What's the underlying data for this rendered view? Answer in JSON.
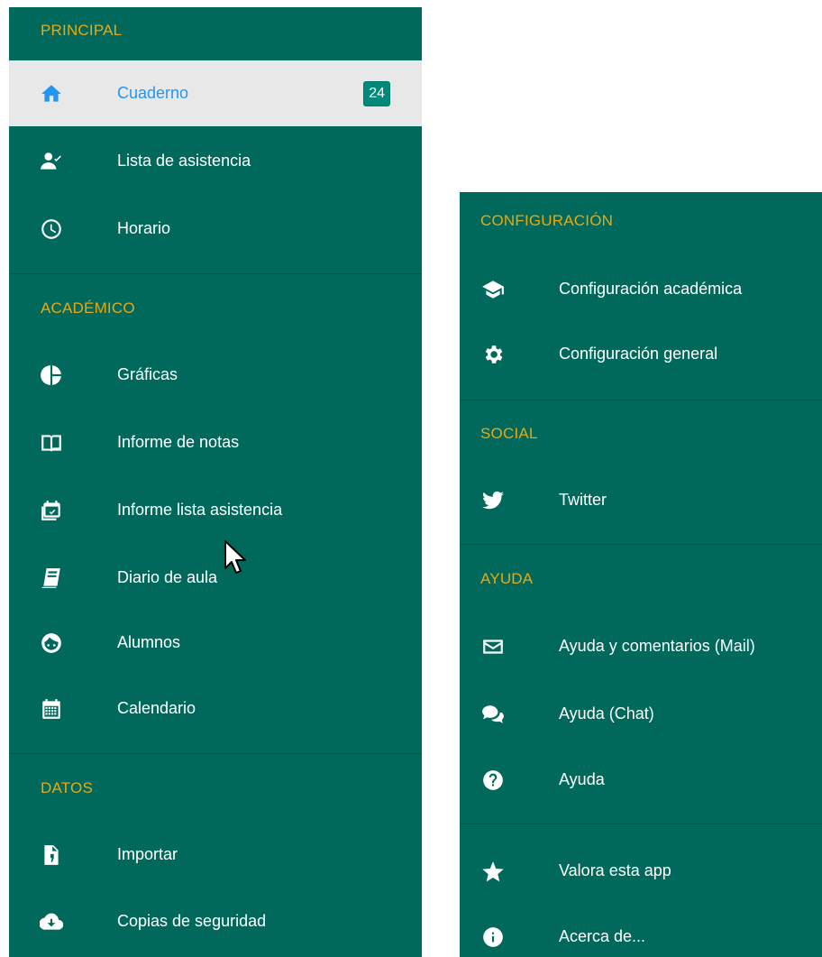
{
  "left_panel": {
    "principal": {
      "header": "PRINCIPAL",
      "items": [
        {
          "label": "Cuaderno",
          "icon": "home-icon",
          "badge": "24",
          "active": true
        },
        {
          "label": "Lista de asistencia",
          "icon": "person-check-icon"
        },
        {
          "label": "Horario",
          "icon": "clock-icon"
        }
      ]
    },
    "academico": {
      "header": "ACADÉMICO",
      "items": [
        {
          "label": "Gráficas",
          "icon": "pie-chart-icon"
        },
        {
          "label": "Informe de notas",
          "icon": "book-open-icon"
        },
        {
          "label": "Informe lista asistencia",
          "icon": "calendar-check-icon"
        },
        {
          "label": "Diario de aula",
          "icon": "notebook-icon"
        },
        {
          "label": "Alumnos",
          "icon": "face-icon"
        },
        {
          "label": "Calendario",
          "icon": "calendar-grid-icon"
        }
      ]
    },
    "datos": {
      "header": "DATOS",
      "items": [
        {
          "label": "Importar",
          "icon": "file-import-icon"
        },
        {
          "label": "Copias de seguridad",
          "icon": "cloud-download-icon"
        }
      ]
    }
  },
  "right_panel": {
    "configuracion": {
      "header": "CONFIGURACIÓN",
      "items": [
        {
          "label": "Configuración académica",
          "icon": "graduation-cap-icon"
        },
        {
          "label": "Configuración general",
          "icon": "gear-icon"
        }
      ]
    },
    "social": {
      "header": "SOCIAL",
      "items": [
        {
          "label": "Twitter",
          "icon": "twitter-bird-icon"
        }
      ]
    },
    "ayuda": {
      "header": "AYUDA",
      "items": [
        {
          "label": "Ayuda y comentarios (Mail)",
          "icon": "mail-icon"
        },
        {
          "label": "Ayuda (Chat)",
          "icon": "chat-bubbles-icon"
        },
        {
          "label": "Ayuda",
          "icon": "question-circle-icon"
        }
      ]
    },
    "extra": {
      "items": [
        {
          "label": "Valora esta app",
          "icon": "star-icon"
        },
        {
          "label": "Acerca de...",
          "icon": "info-circle-icon"
        }
      ]
    }
  },
  "colors": {
    "panel_bg": "#00695c",
    "header_text": "#e6a916",
    "active_bg": "#e8e8e8",
    "active_text": "#2196f3",
    "badge_bg": "#00897b"
  }
}
